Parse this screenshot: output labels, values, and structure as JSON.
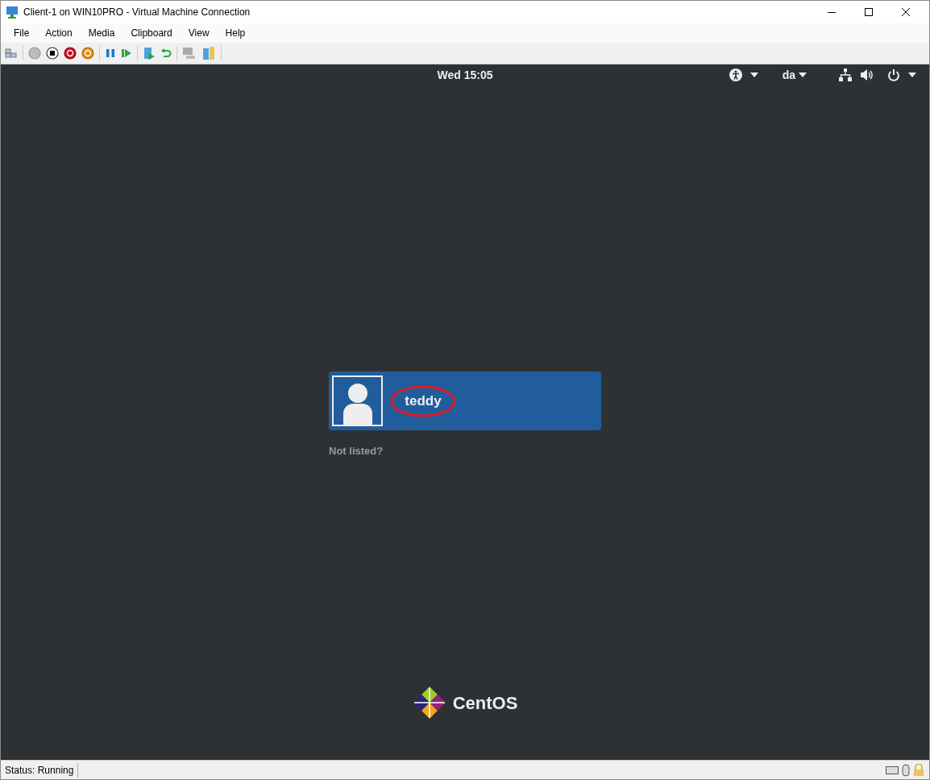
{
  "window": {
    "title": "Client-1 on WIN10PRO - Virtual Machine Connection"
  },
  "menu": [
    "File",
    "Action",
    "Media",
    "Clipboard",
    "View",
    "Help"
  ],
  "top_bar": {
    "clock": "Wed 15:05",
    "language": "da"
  },
  "users": [
    {
      "name": "teddy",
      "selected": true,
      "circled": true
    }
  ],
  "not_listed": "Not listed?",
  "logo": {
    "text": "CentOS"
  },
  "status_bar": {
    "text": "Status: Running"
  }
}
